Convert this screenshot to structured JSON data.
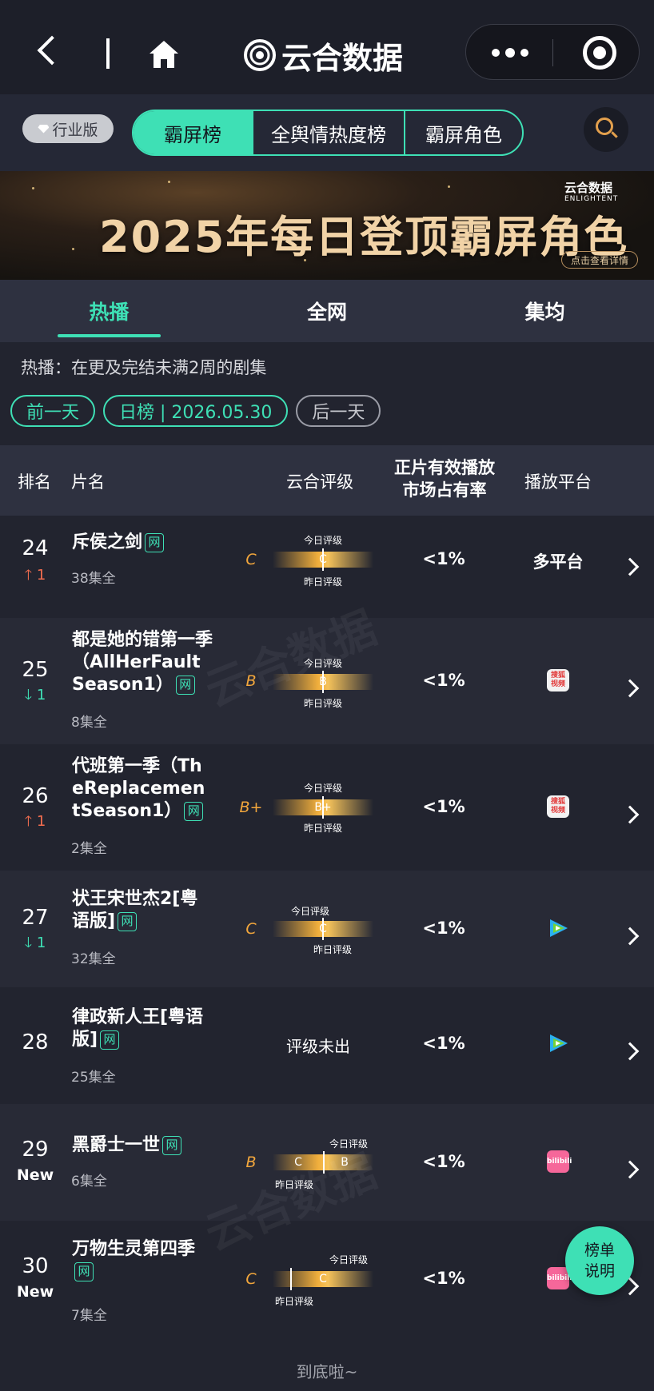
{
  "app": {
    "brand": "云合数据"
  },
  "filter": {
    "edition": "行业版",
    "segments": [
      "霸屏榜",
      "全舆情热度榜",
      "霸屏角色"
    ]
  },
  "banner": {
    "title": "2025年每日登顶霸屏角色",
    "logo_cn": "云合数据",
    "logo_en": "ENLIGHTENT",
    "button": "点击查看详情"
  },
  "tabs": [
    "热播",
    "全网",
    "集均"
  ],
  "description": "热播：在更及完结未满2周的剧集",
  "date_pills": {
    "prev": "前一天",
    "current": "日榜 | 2026.05.30",
    "next": "后一天"
  },
  "table_header": {
    "rank": "排名",
    "name": "片名",
    "rating": "云合评级",
    "share_line1": "正片有效播放",
    "share_line2": "市场占有率",
    "platform": "播放平台"
  },
  "rating_labels": {
    "today": "今日评级",
    "yesterday": "昨日评级"
  },
  "net_tag": "网",
  "rows": [
    {
      "rank": "24",
      "change": "1",
      "direction": "up",
      "title": "斥侯之剑",
      "episodes": "38集全",
      "grade": "C",
      "bar_grade": "C",
      "share": "<1%",
      "platform": "多平台",
      "platform_icon": "none"
    },
    {
      "rank": "25",
      "change": "1",
      "direction": "down",
      "title": "都是她的错第一季（AllHerFault Season1）",
      "episodes": "8集全",
      "grade": "B",
      "bar_grade": "B",
      "share": "<1%",
      "platform": "",
      "platform_icon": "sohu-video-icon"
    },
    {
      "rank": "26",
      "change": "1",
      "direction": "up",
      "title": "代班第一季（TheReplacementSeason1）",
      "episodes": "2集全",
      "grade": "B+",
      "bar_grade": "B+",
      "share": "<1%",
      "platform": "",
      "platform_icon": "sohu-video-icon"
    },
    {
      "rank": "27",
      "change": "1",
      "direction": "down",
      "title": "状王宋世杰2[粤语版]",
      "episodes": "32集全",
      "grade": "C",
      "bar_grade": "C",
      "share": "<1%",
      "platform": "",
      "platform_icon": "tencent-video-icon"
    },
    {
      "rank": "28",
      "change": "",
      "direction": "none",
      "title": "律政新人王[粤语版]",
      "episodes": "25集全",
      "grade": "",
      "bar_grade": "",
      "unrated": "评级未出",
      "share": "<1%",
      "platform": "",
      "platform_icon": "tencent-video-icon"
    },
    {
      "rank": "29",
      "change": "New",
      "direction": "new",
      "title": "黑爵士一世",
      "episodes": "6集全",
      "grade": "B",
      "bar_yesterday": "C",
      "bar_today": "B",
      "share": "<1%",
      "platform": "",
      "platform_icon": "bilibili-icon"
    },
    {
      "rank": "30",
      "change": "New",
      "direction": "new",
      "title": "万物生灵第四季",
      "episodes": "7集全",
      "grade": "C",
      "bar_grade": "C",
      "share": "<1%",
      "platform": "",
      "platform_icon": "bilibili-icon"
    }
  ],
  "platform_icon_text": {
    "sohu_top": "搜狐",
    "sohu_bottom": "视频",
    "bili": "bilibili"
  },
  "fab": {
    "line1": "榜单",
    "line2": "说明"
  },
  "footer": "到底啦~",
  "colors": {
    "accent": "#3ee0b5",
    "up": "#f36d4f",
    "grade": "#f3a73c",
    "background": "#22242f"
  }
}
